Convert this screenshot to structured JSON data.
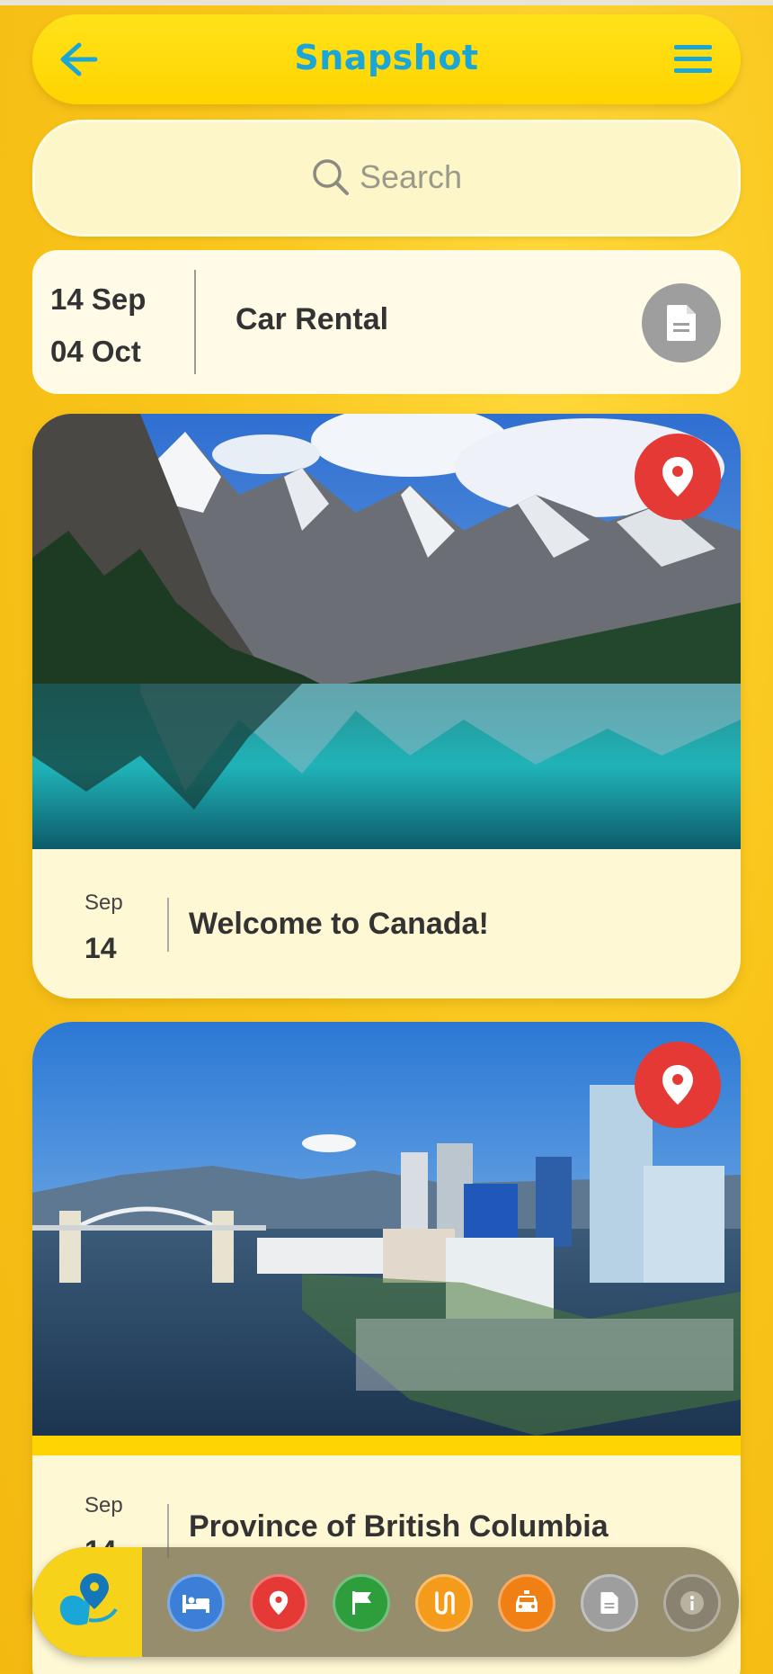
{
  "header": {
    "title": "Snapshot"
  },
  "search": {
    "placeholder": "Search"
  },
  "rental": {
    "start_date": "14 Sep",
    "end_date": "04 Oct",
    "label": "Car Rental"
  },
  "cards": [
    {
      "month": "Sep",
      "day": "14",
      "title": "Welcome to Canada!"
    },
    {
      "month": "Sep",
      "day": "14",
      "title": "Province of British Columbia"
    }
  ],
  "dock": {
    "items": [
      {
        "icon": "bed-icon",
        "color": "#3b7fd8"
      },
      {
        "icon": "location-pin-icon",
        "color": "#e53935"
      },
      {
        "icon": "flag-icon",
        "color": "#2e9e3c"
      },
      {
        "icon": "route-icon",
        "color": "#f59b1b"
      },
      {
        "icon": "car-icon",
        "color": "#f07f14"
      },
      {
        "icon": "document-icon",
        "color": "#9e9e9e"
      },
      {
        "icon": "info-icon",
        "color": "#8a8270"
      }
    ]
  },
  "colors": {
    "accent": "#1aa6d6",
    "background": "#f9c51a",
    "pin": "#e53935"
  }
}
